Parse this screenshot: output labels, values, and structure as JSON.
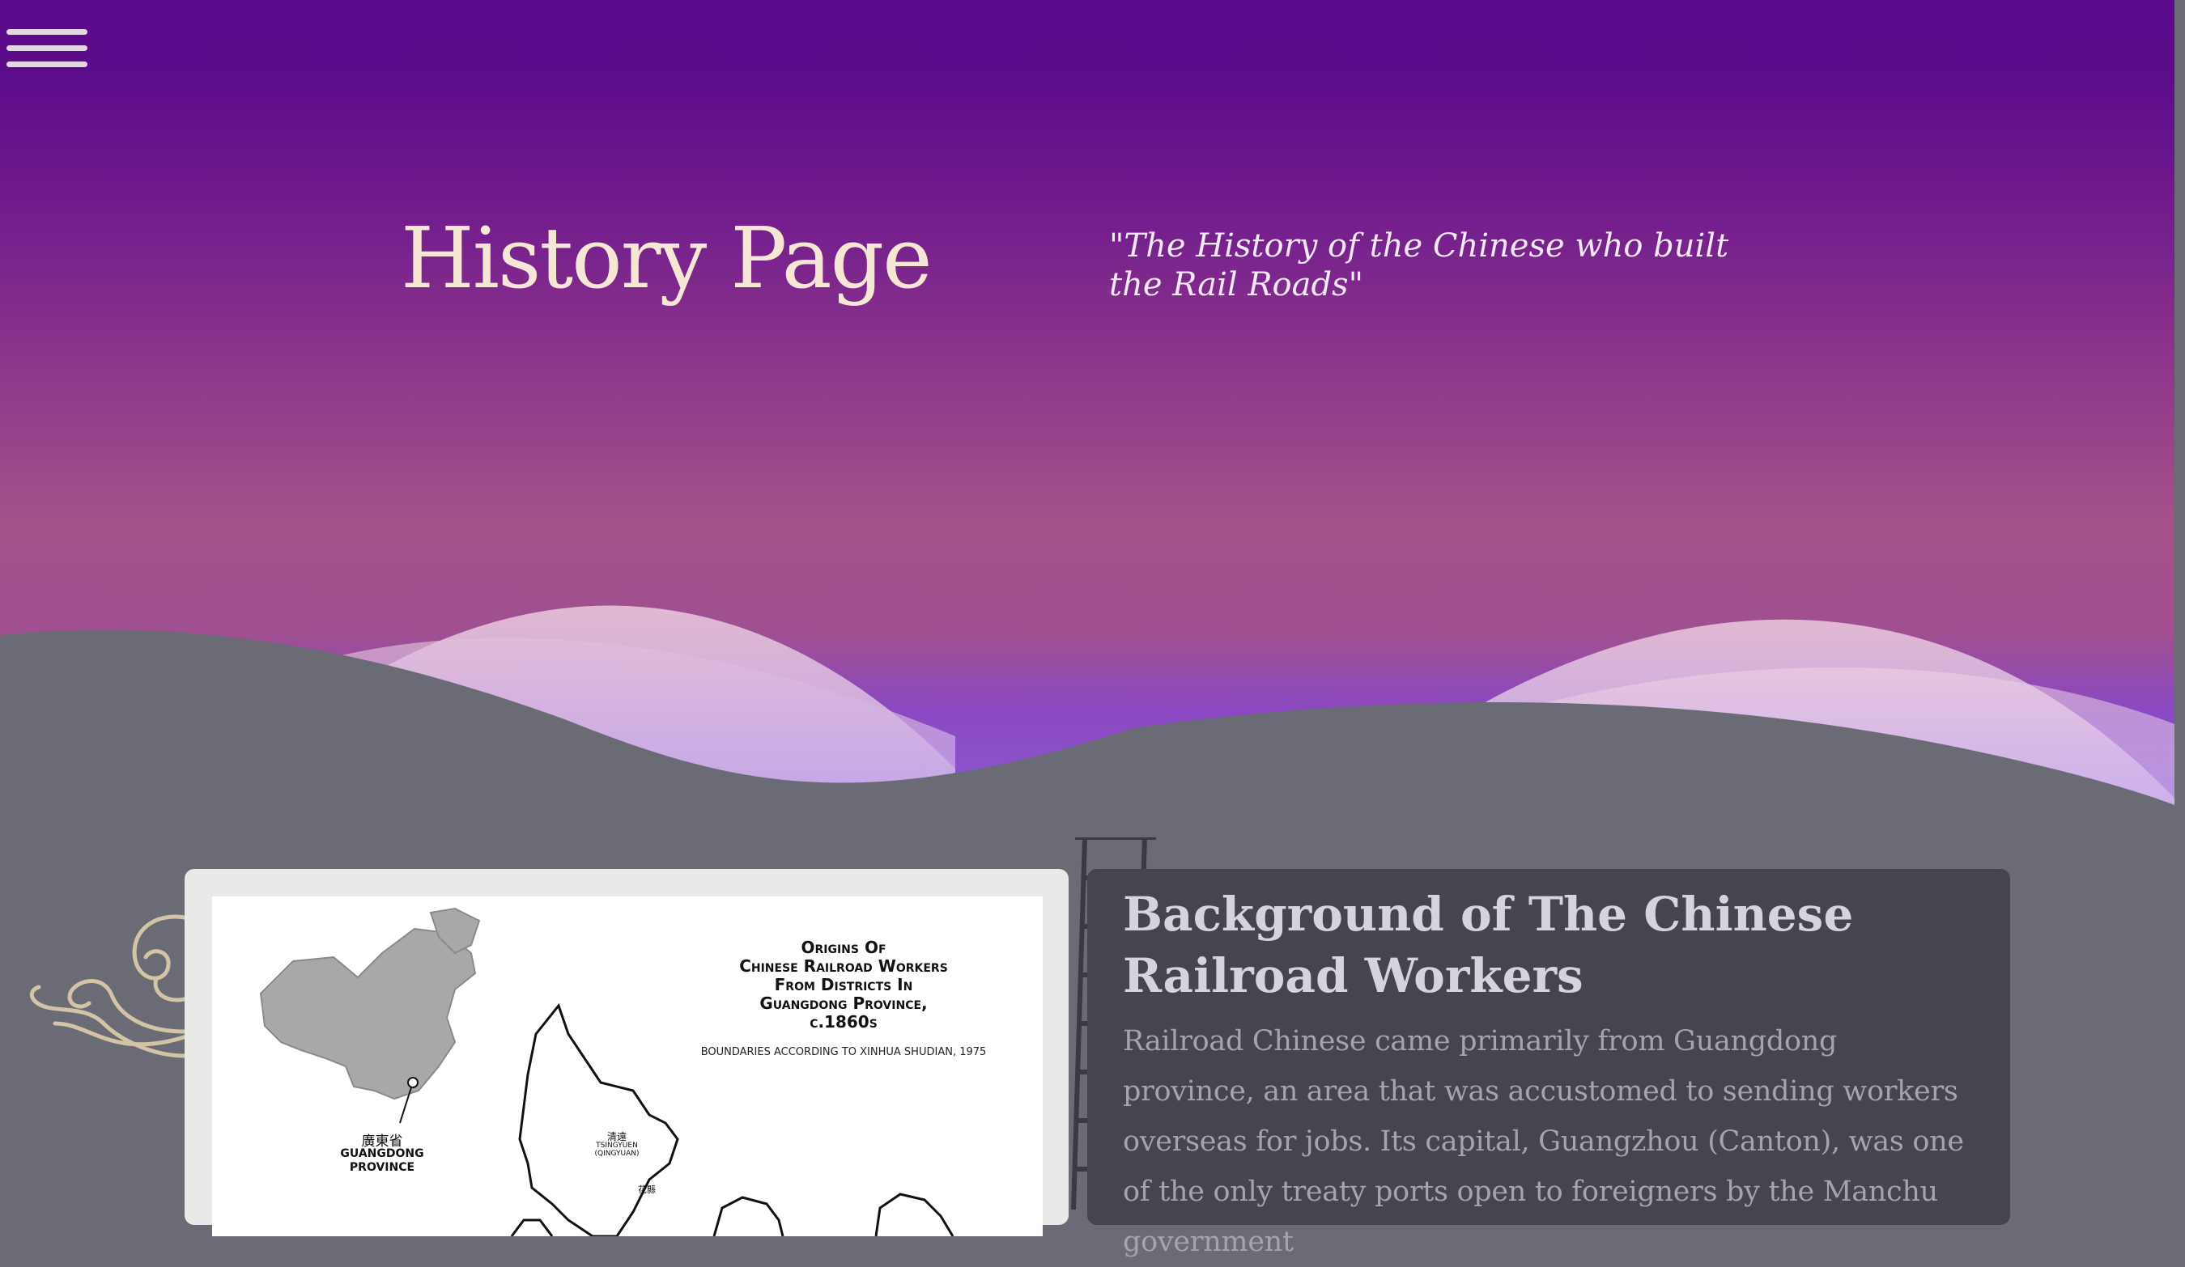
{
  "header": {
    "menu_icon": "hamburger-menu-icon",
    "title": "History Page",
    "quote": "\"The History of the Chinese who built the Rail Roads\""
  },
  "colors": {
    "sky_top": "#5a0a8c",
    "sky_bottom": "#a4528a",
    "hills": "#6b6b76",
    "title": "#f6e6d4",
    "card_dark": "#45454f",
    "card_light": "#e9e9e8"
  },
  "decorations": {
    "cloud_icon": "cloud-swirl-icon",
    "ladder_icon": "ladder-icon"
  },
  "map": {
    "title": "Origins Of\nChinese Railroad Workers\nFrom Districts In\nGuangdong Province,\nc.1860s",
    "subtitle": "BOUNDARIES ACCORDING TO XINHUA SHUDIAN, 1975",
    "labels": {
      "guangdong_zh": "廣東省",
      "guangdong_en": "GUANGDONG\nPROVINCE",
      "tsingyuen_zh": "清遠",
      "tsingyuen_en": "TSINGYUEN\n(QINGYUAN)",
      "fahsien_zh": "花縣"
    }
  },
  "article": {
    "heading": "Background of The Chinese Railroad Workers",
    "body": "Railroad Chinese came primarily from Guangdong province, an area that was accustomed to sending workers overseas for jobs. Its capital, Guangzhou (Canton), was one of the only treaty ports open to foreigners by the Manchu government"
  }
}
